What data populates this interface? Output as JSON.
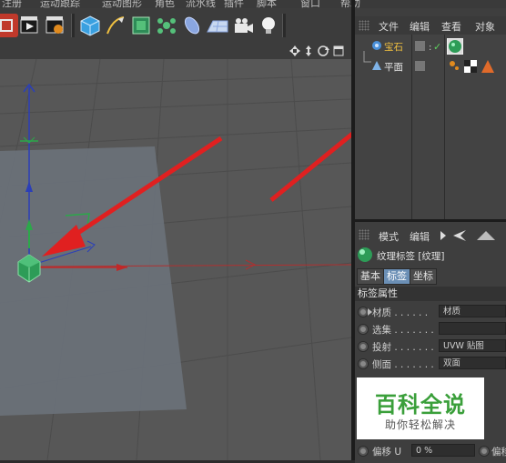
{
  "menu": {
    "items": [
      "注册",
      "运动跟踪",
      "运动图形",
      "角色",
      "流水线",
      "插件",
      "脚本",
      "窗口",
      "帮助"
    ]
  },
  "toolbar": {
    "buttons": [
      "keyframe-icon",
      "render-icon",
      "render-settings-icon",
      "cube-icon",
      "pen-icon",
      "subdivide-icon",
      "cloner-icon",
      "deformer-icon",
      "floor-icon",
      "camera-icon",
      "light-icon"
    ]
  },
  "object_manager": {
    "tabs": [
      "文件",
      "编辑",
      "查看",
      "对象"
    ],
    "objects": [
      {
        "name": "宝石",
        "color": "#f0c040"
      },
      {
        "name": "平面",
        "color": "#e8e8e8"
      }
    ]
  },
  "attribute_manager": {
    "tabs": [
      "模式",
      "编辑"
    ],
    "title": "纹理标签 [纹理]",
    "subtabs": [
      "基本",
      "标签",
      "坐标"
    ],
    "active_subtab": "标签",
    "section": "标签属性",
    "properties": [
      {
        "label": "材质 . . . . . .",
        "value": "材质"
      },
      {
        "label": "选集 . . . . . . .",
        "value": ""
      },
      {
        "label": "投射 . . . . . . .",
        "value": "UVW 贴图"
      },
      {
        "label": "侧面 . . . . . . .",
        "value": "双面"
      }
    ],
    "bottom_row": {
      "label": "偏移 U",
      "value": "0 %",
      "label2": "偏移"
    }
  },
  "watermark": {
    "title": "百科全说",
    "subtitle": "助你轻松解决"
  },
  "colors": {
    "arrow": "#e02020",
    "accent": "#6b8fb5",
    "watermark": "#3a9f3a"
  }
}
